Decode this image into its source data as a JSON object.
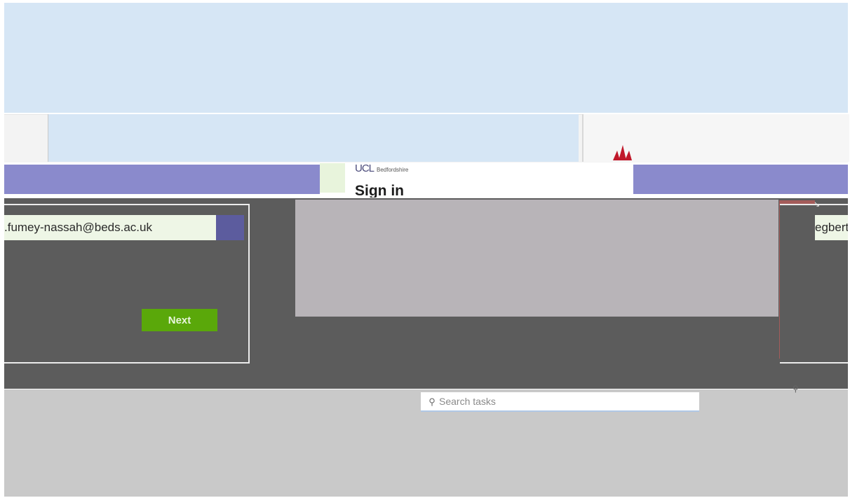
{
  "signin": {
    "heading": "Sign in",
    "university": "Bedfordshire",
    "email_value": ".fumey-nassah@beds.ac.uk",
    "next_label": "Next"
  },
  "right_panel": {
    "email_value": "egbert."
  },
  "taskbar": {
    "search_placeholder": "Search tasks"
  },
  "colors": {
    "accent_purple": "#8a8acc",
    "next_green": "#5aa80a",
    "brand_red": "#c0182a"
  }
}
